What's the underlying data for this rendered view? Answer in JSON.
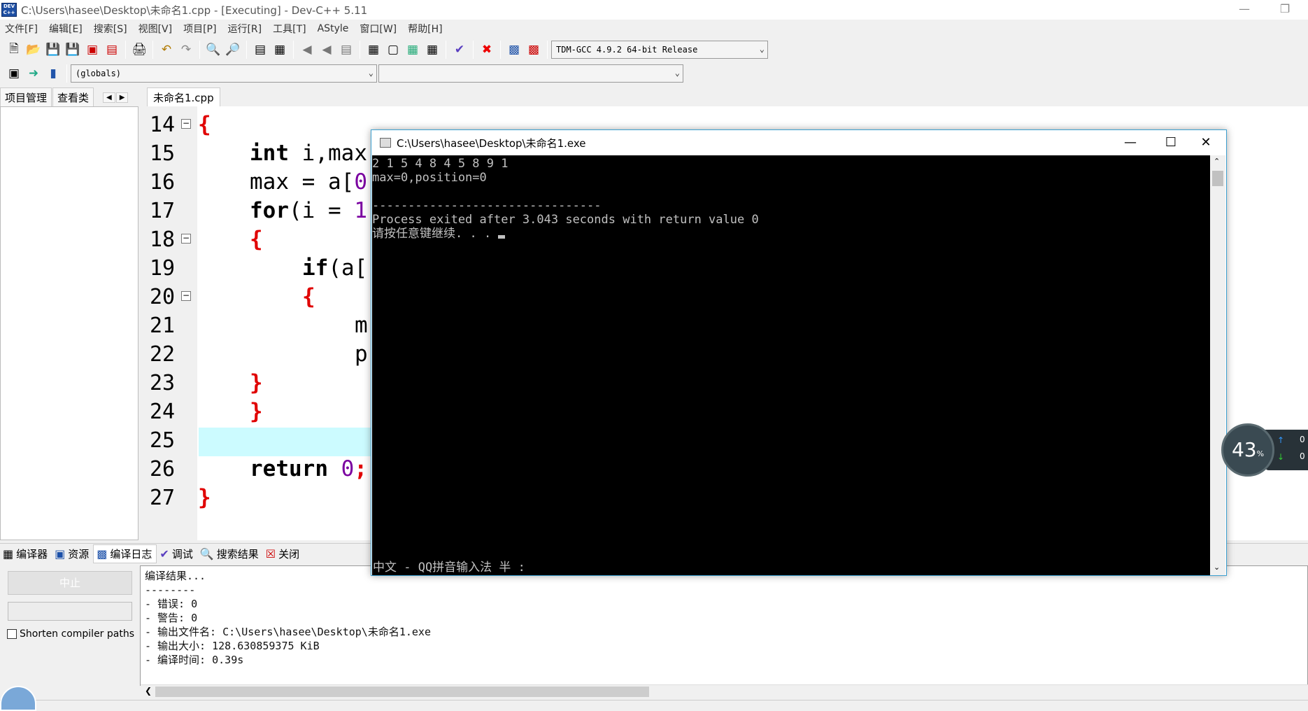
{
  "window": {
    "title": "C:\\Users\\hasee\\Desktop\\未命名1.cpp - [Executing] - Dev-C++ 5.11",
    "app_icon_text": "DEV C++"
  },
  "menu": [
    "文件[F]",
    "编辑[E]",
    "搜索[S]",
    "视图[V]",
    "项目[P]",
    "运行[R]",
    "工具[T]",
    "AStyle",
    "窗口[W]",
    "帮助[H]"
  ],
  "toolbar": {
    "compiler": "TDM-GCC 4.9.2 64-bit Release",
    "scope": "(globals)",
    "function": ""
  },
  "left_tabs": [
    "项目管理",
    "查看类"
  ],
  "editor": {
    "tab": "未命名1.cpp",
    "line_numbers": [
      "14",
      "15",
      "16",
      "17",
      "18",
      "19",
      "20",
      "21",
      "22",
      "23",
      "24",
      "25",
      "26",
      "27"
    ],
    "code": {
      "l14": "{",
      "l15a": "int",
      "l15b": " i,max",
      "l16a": "max = a[",
      "l16b": "0",
      "l17a": "for",
      "l17b": "(i = ",
      "l17c": "1",
      "l18": "{",
      "l19a": "if",
      "l19b": "(a[",
      "l20": "{",
      "l21": "m",
      "l22": "p",
      "l23": "}",
      "l24": "}",
      "l26a": "return",
      "l26b": "0",
      "l27": "}"
    }
  },
  "bottom_tabs": [
    {
      "icon": "grid-icon",
      "label": "编译器"
    },
    {
      "icon": "resource-icon",
      "label": "资源"
    },
    {
      "icon": "bar-chart-icon",
      "label": "编译日志"
    },
    {
      "icon": "check-icon",
      "label": "调试"
    },
    {
      "icon": "search-results-icon",
      "label": "搜索结果"
    },
    {
      "icon": "close-icon",
      "label": "关闭"
    }
  ],
  "compile": {
    "stop_label": "中止",
    "shorten_label": "Shorten compiler paths",
    "log": "编译结果...\n--------\n- 错误: 0\n- 警告: 0\n- 输出文件名: C:\\Users\\hasee\\Desktop\\未命名1.exe\n- 输出大小: 128.630859375 KiB\n- 编译时间: 0.39s"
  },
  "console": {
    "title": "C:\\Users\\hasee\\Desktop\\未命名1.exe",
    "output": "2 1 5 4 8 4 5 8 9 1\nmax=0,position=0\n\n--------------------------------\nProcess exited after 3.043 seconds with return value 0\n请按任意键继续. . . ",
    "ime": "中文 - QQ拼音输入法 半 :"
  },
  "gauge": {
    "percent": "43",
    "unit": "%",
    "up": "0",
    "down": "0"
  }
}
